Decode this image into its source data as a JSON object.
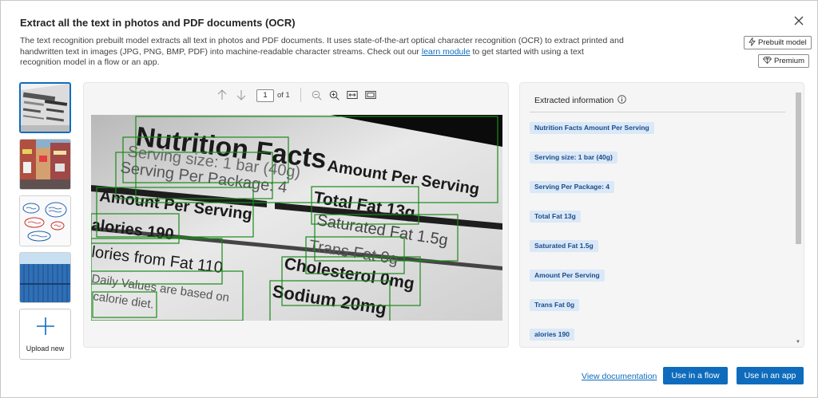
{
  "dialog": {
    "title": "Extract all the text in photos and PDF documents (OCR)",
    "description_before": "The text recognition prebuilt model extracts all text in photos and PDF documents. It uses state-of-the-art optical character recognition (OCR) to extract printed and handwritten text in images (JPG, PNG, BMP, PDF) into machine-readable character streams. Check out our ",
    "description_link": "learn module",
    "description_after": " to get started with using a text recognition model in a flow or an app.",
    "tags": {
      "prebuilt": "Prebuilt model",
      "premium": "Premium"
    }
  },
  "thumbnails": {
    "upload_label": "Upload new"
  },
  "viewer": {
    "page_value": "1",
    "page_of": "of 1",
    "image_text": {
      "t1": "Nutrition Facts",
      "t2": "Serving size: 1 bar (40g)",
      "t3": "Serving Per Package: 4",
      "t4": "Amount Per Serving",
      "t5": "Amount Per Serving",
      "t6": "Total Fat 13g",
      "t7": "Saturated Fat 1.5g",
      "t8": "alories 190",
      "t9": "Trans Fat 0g",
      "t10": "lories from Fat 110",
      "t11": "Cholesterol 0mg",
      "t12": "Daily Values are based on",
      "t13": "calorie diet.",
      "t14": "Sodium 20mg"
    }
  },
  "panel": {
    "title": "Extracted information",
    "items": [
      "Nutrition Facts Amount Per Serving",
      "Serving size: 1 bar (40g)",
      "Serving Per Package: 4",
      "Total Fat 13g",
      "Saturated Fat 1.5g",
      "Amount Per Serving",
      "Trans Fat 0g",
      "alories 190"
    ]
  },
  "footer": {
    "doc_link": "View documentation",
    "flow_button": "Use in a flow",
    "app_button": "Use in an app"
  },
  "colors": {
    "accent": "#0f6cbd",
    "bbox": "#1a8a1a",
    "chip_bg": "#dbe8f7"
  }
}
